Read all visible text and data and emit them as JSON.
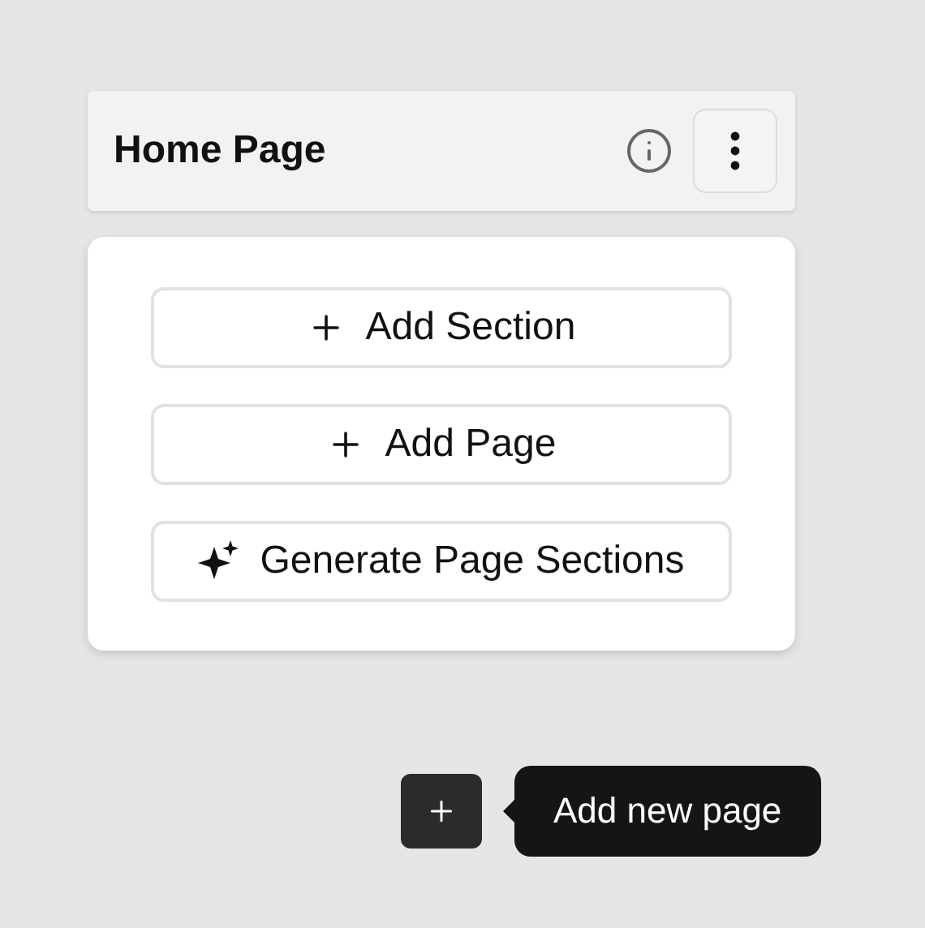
{
  "header": {
    "title": "Home Page"
  },
  "menu": [
    {
      "label": "Add Section",
      "kind": "add"
    },
    {
      "label": "Add Page",
      "kind": "add"
    },
    {
      "label": "Generate Page Sections",
      "kind": "generate"
    }
  ],
  "tooltip": {
    "text": "Add new page"
  }
}
